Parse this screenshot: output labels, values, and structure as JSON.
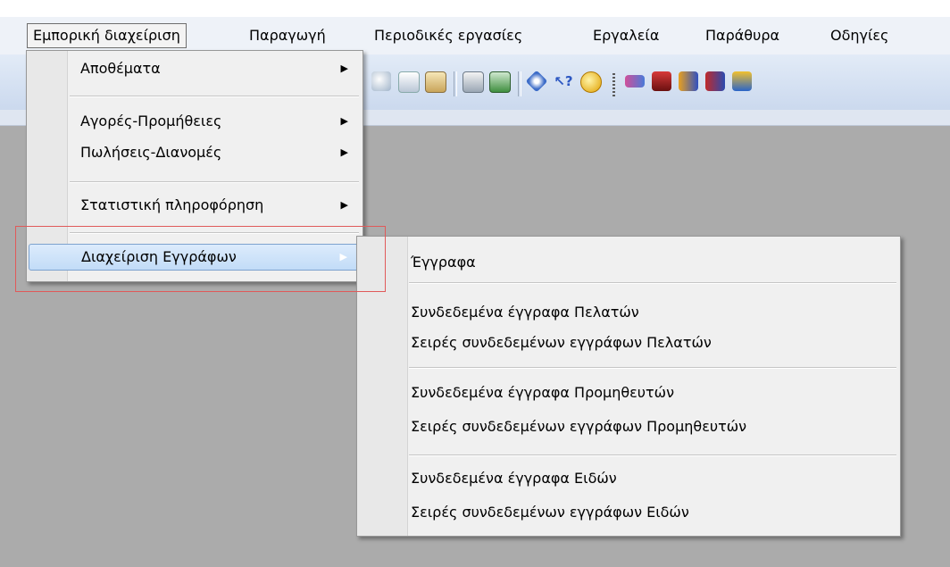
{
  "menubar": {
    "items": [
      {
        "label": "Εμπορική διαχείριση"
      },
      {
        "label": "Παραγωγή"
      },
      {
        "label": "Περιοδικές εργασίες"
      },
      {
        "label": "Εργαλεία"
      },
      {
        "label": "Παράθυρα"
      },
      {
        "label": "Οδηγίες"
      }
    ]
  },
  "main_menu": {
    "items": [
      {
        "label": "Αποθέματα"
      },
      {
        "label": "Αγορές-Προμήθειες"
      },
      {
        "label": "Πωλήσεις-Διανομές"
      },
      {
        "label": "Στατιστική πληροφόρηση"
      },
      {
        "label": "Διαχείριση Εγγράφων"
      }
    ],
    "arrow": "▶"
  },
  "submenu": {
    "items": [
      {
        "label": "Έγγραφα"
      },
      {
        "label": "Συνδεδεμένα έγγραφα Πελατών"
      },
      {
        "label": "Σειρές συνδεδεμένων εγγράφων Πελατών"
      },
      {
        "label": "Συνδεδεμένα έγγραφα Προμηθευτών"
      },
      {
        "label": "Σειρές συνδεδεμένων εγγράφων Προμηθευτών"
      },
      {
        "label": "Συνδεδεμένα έγγραφα Ειδών"
      },
      {
        "label": "Σειρές συνδεδεμένων εγγράφων Ειδών"
      }
    ]
  },
  "toolbar": {
    "icons": [
      "cut-icon",
      "copy-icon",
      "paste-icon",
      "print-icon",
      "preview-icon",
      "navigate-icon",
      "help-pointer-icon",
      "currency-icon",
      "customers-icon",
      "suppliers-icon",
      "users-icon",
      "group-icon",
      "route-icon"
    ]
  },
  "colors": {
    "highlight": "#c2dcf7",
    "annotation": "#e05a5a",
    "workspace": "#ababab"
  }
}
